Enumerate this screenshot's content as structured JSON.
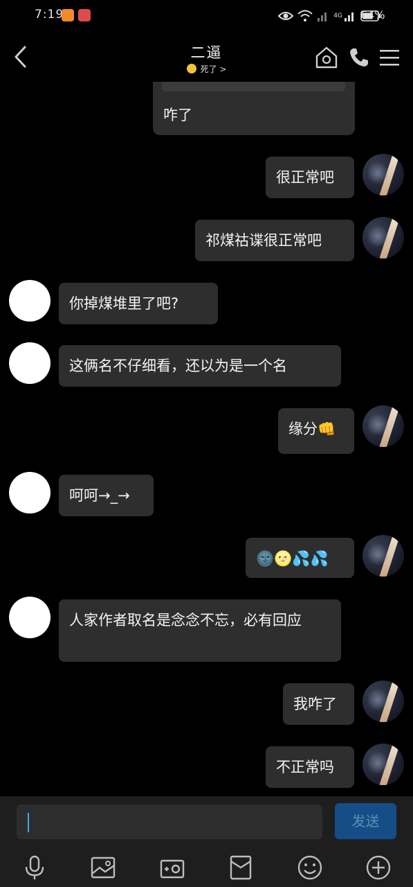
{
  "status_bar": {
    "time": "7:19",
    "network": "4G",
    "battery": "64%"
  },
  "header": {
    "title": "二逼",
    "subtitle": "死了 >"
  },
  "messages": [
    {
      "side": "left",
      "text": "咋了"
    },
    {
      "side": "right",
      "text": "很正常吧"
    },
    {
      "side": "right",
      "text": "祁煤祜谍很正常吧"
    },
    {
      "side": "left",
      "text": "你掉煤堆里了吧?"
    },
    {
      "side": "left",
      "text": "这俩名不仔细看，还以为是一个名"
    },
    {
      "side": "right",
      "text": "缘分👊"
    },
    {
      "side": "left",
      "text": "呵呵→_→"
    },
    {
      "side": "right",
      "text": "🌚🌝💦💦"
    },
    {
      "side": "left",
      "text": "人家作者取名是念念不忘，必有回应"
    },
    {
      "side": "right",
      "text": "我咋了"
    },
    {
      "side": "right",
      "text": "不正常吗"
    }
  ],
  "input": {
    "value": "",
    "send_label": "发送"
  },
  "toolbar": [
    "voice-icon",
    "image-icon",
    "camera-icon",
    "red-packet-icon",
    "emoji-icon",
    "plus-icon"
  ],
  "colors": {
    "bubble": "#2e2e2e",
    "background": "#000000",
    "send_button": "#154e86",
    "caret": "#4aa3e8"
  }
}
